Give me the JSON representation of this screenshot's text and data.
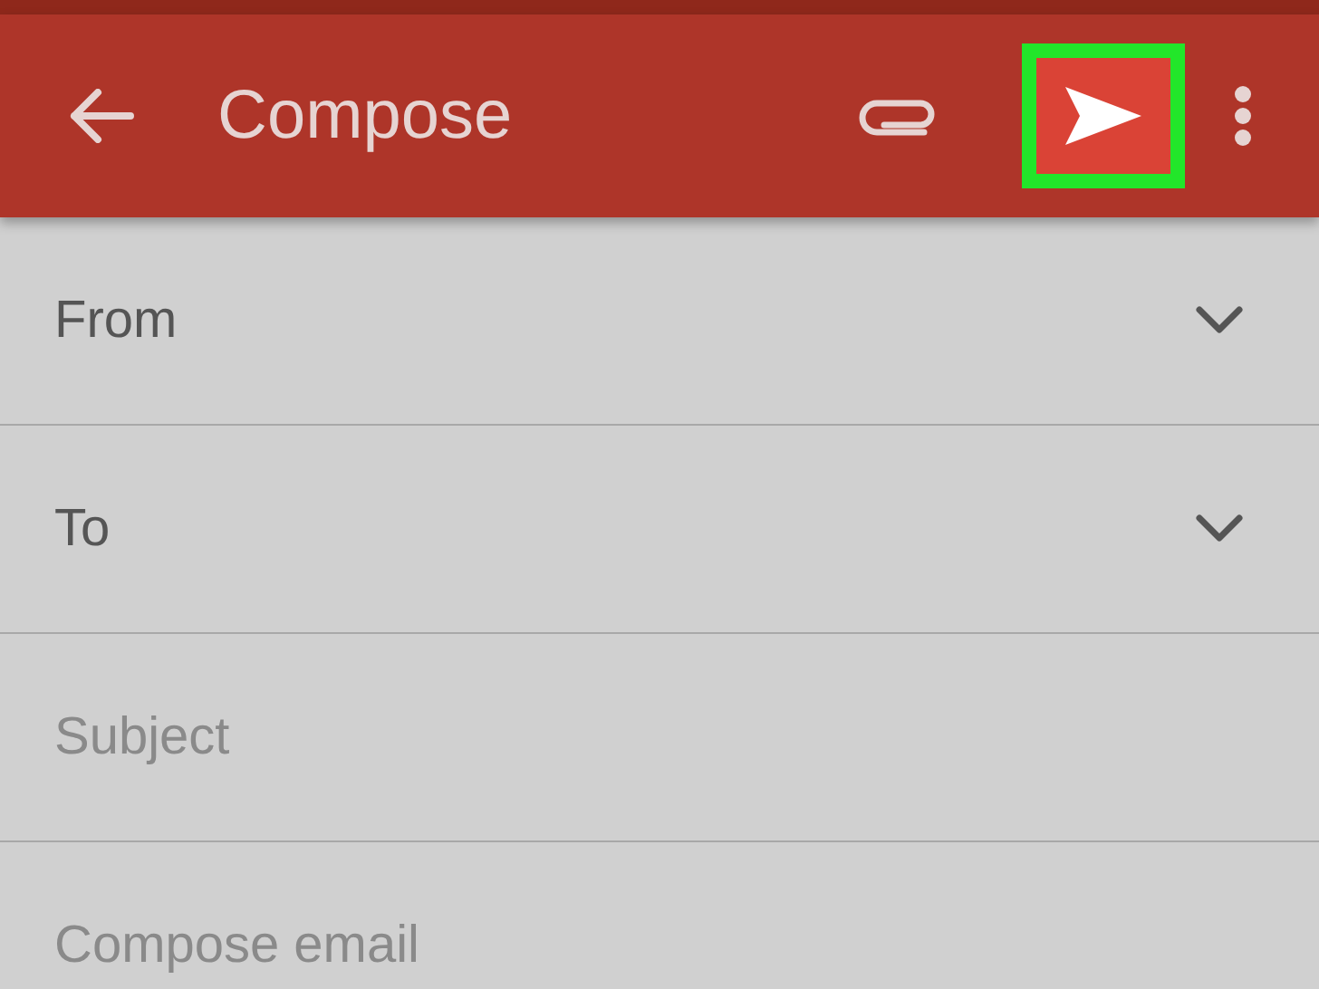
{
  "app_bar": {
    "title": "Compose",
    "send_highlighted": true
  },
  "fields": [
    {
      "kind": "select",
      "label": "From"
    },
    {
      "kind": "select",
      "label": "To"
    },
    {
      "kind": "text",
      "placeholder": "Subject"
    },
    {
      "kind": "text",
      "placeholder": "Compose email"
    }
  ]
}
